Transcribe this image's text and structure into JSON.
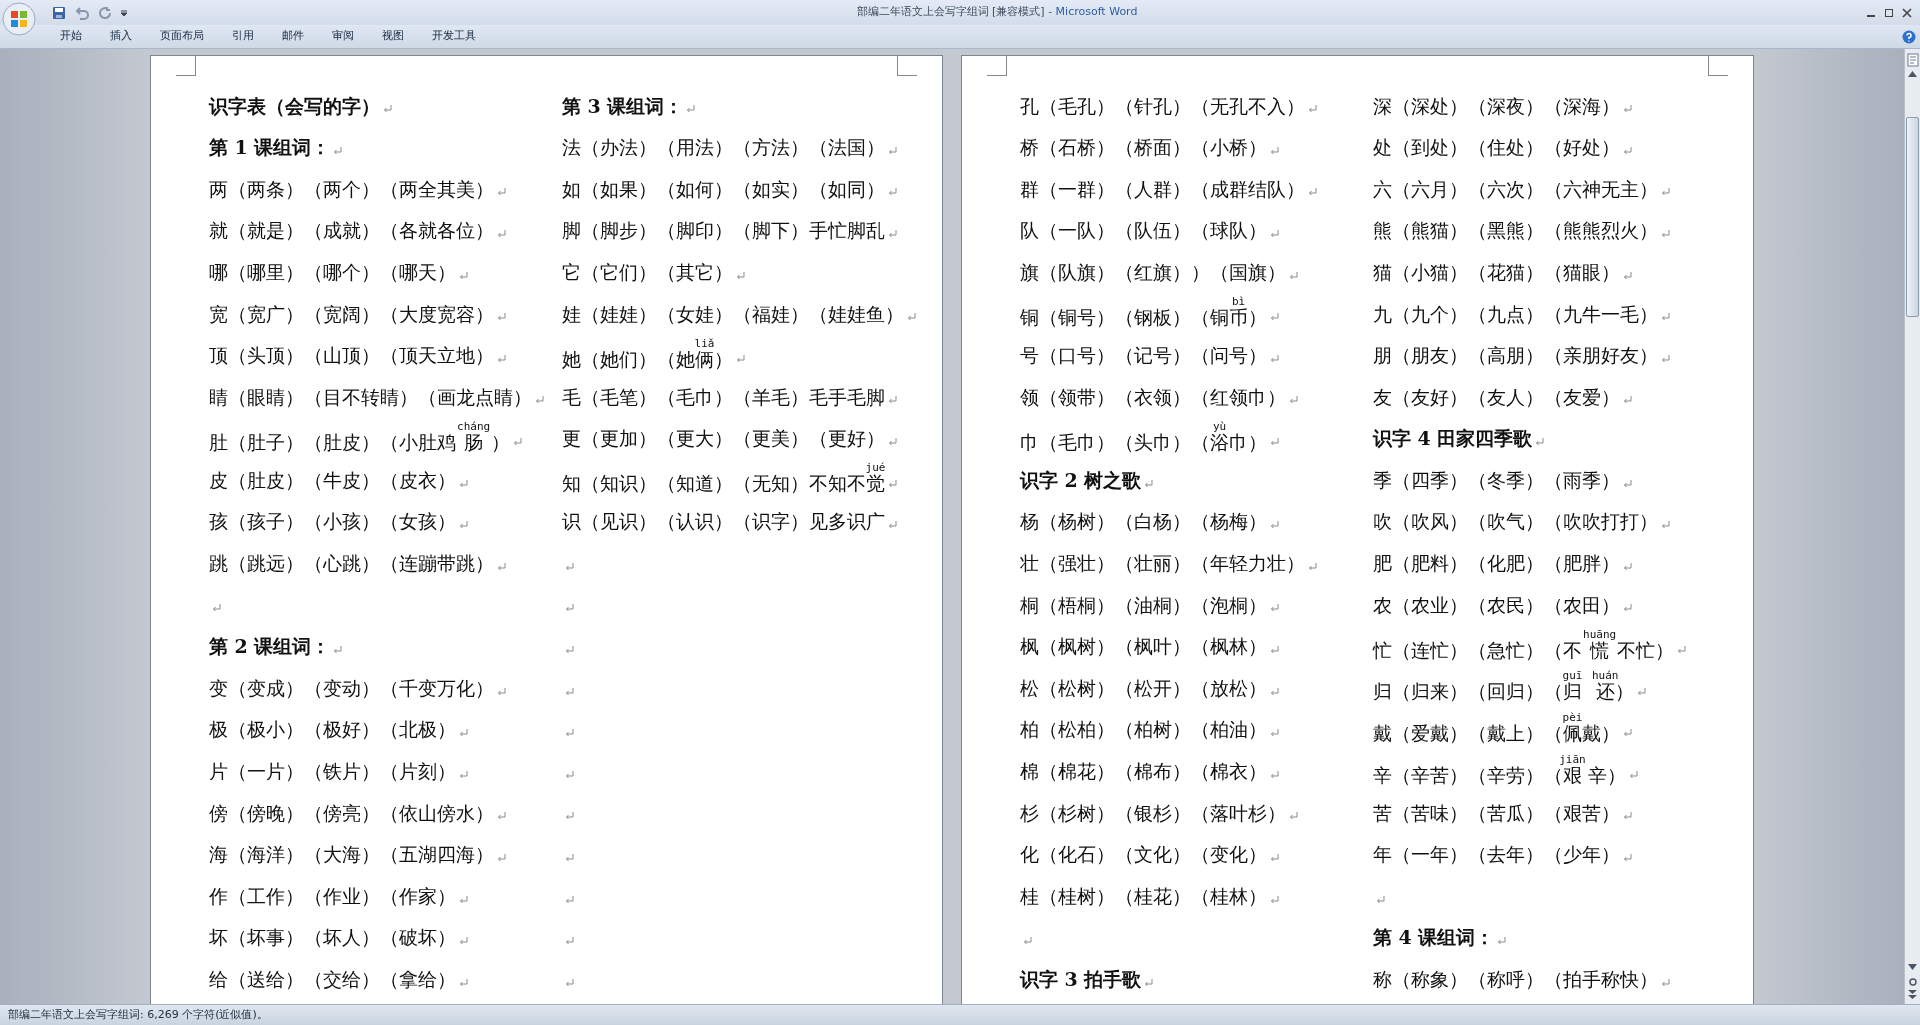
{
  "window": {
    "document": "部编二年语文上会写字组词 [兼容模式]",
    "app": "- Microsoft Word"
  },
  "ribbon_tabs": [
    {
      "label": "开始",
      "selected": false
    },
    {
      "label": "插入",
      "selected": false
    },
    {
      "label": "页面布局",
      "selected": false
    },
    {
      "label": "引用",
      "selected": false
    },
    {
      "label": "邮件",
      "selected": false
    },
    {
      "label": "审阅",
      "selected": false
    },
    {
      "label": "视图",
      "selected": false
    },
    {
      "label": "开发工具",
      "selected": false
    }
  ],
  "pages": [
    {
      "columns": [
        [
          {
            "kind": "heading",
            "text": "识字表（会写的字）"
          },
          {
            "kind": "heading",
            "text": "第 1 课组词："
          },
          {
            "kind": "entry",
            "text": "两（两条）（两个）（两全其美）"
          },
          {
            "kind": "entry",
            "text": "就（就是）（成就）（各就各位）"
          },
          {
            "kind": "entry",
            "text": "哪（哪里）（哪个）（哪天）"
          },
          {
            "kind": "entry",
            "text": "宽（宽广）（宽阔）（大度宽容）"
          },
          {
            "kind": "entry",
            "text": "顶（头顶）（山顶）（顶天立地）"
          },
          {
            "kind": "entry",
            "text": "睛（眼睛）（目不转睛）（画龙点睛）"
          },
          {
            "kind": "entry",
            "parts": [
              {
                "text": "肚（肚子）（肚皮）（小肚鸡 "
              },
              {
                "base": "肠",
                "pinyin": "cháng"
              },
              {
                "text": " ）"
              }
            ]
          },
          {
            "kind": "entry",
            "text": "皮（肚皮）（牛皮）（皮衣）"
          },
          {
            "kind": "entry",
            "text": "孩（孩子）（小孩）（女孩）"
          },
          {
            "kind": "entry",
            "text": "跳（跳远）（心跳）（连蹦带跳）"
          },
          {
            "kind": "empty"
          },
          {
            "kind": "heading",
            "text": "第 2 课组词："
          },
          {
            "kind": "entry",
            "text": "变（变成）（变动）（千变万化）"
          },
          {
            "kind": "entry",
            "text": "极（极小）（极好）（北极）"
          },
          {
            "kind": "entry",
            "text": "片（一片）（铁片）（片刻）"
          },
          {
            "kind": "entry",
            "text": "傍（傍晚）（傍亮）（依山傍水）"
          },
          {
            "kind": "entry",
            "text": "海（海洋）（大海）（五湖四海）"
          },
          {
            "kind": "entry",
            "text": "作（工作）（作业）（作家）"
          },
          {
            "kind": "entry",
            "text": "坏（坏事）（坏人）（破坏）"
          },
          {
            "kind": "entry",
            "text": "给（送给）（交给）（拿给）"
          }
        ],
        [
          {
            "kind": "heading",
            "text": "第 3 课组词："
          },
          {
            "kind": "entry",
            "text": "法（办法）（用法）（方法）（法国）"
          },
          {
            "kind": "entry",
            "text": "如（如果）（如何）（如实）（如同）"
          },
          {
            "kind": "entry",
            "text": "脚（脚步）（脚印）（脚下）手忙脚乱"
          },
          {
            "kind": "entry",
            "text": "它（它们）（其它）"
          },
          {
            "kind": "entry",
            "text": "娃（娃娃）（女娃）（福娃）（娃娃鱼）"
          },
          {
            "kind": "entry",
            "parts": [
              {
                "text": "她（她们）（她"
              },
              {
                "base": "俩",
                "pinyin": "liǎ"
              },
              {
                "text": "）"
              }
            ]
          },
          {
            "kind": "entry",
            "text": "毛（毛笔）（毛巾）（羊毛）毛手毛脚"
          },
          {
            "kind": "entry",
            "text": "更（更加）（更大）（更美）（更好）"
          },
          {
            "kind": "entry",
            "parts": [
              {
                "text": "知（知识）（知道）（无知）不知不"
              },
              {
                "base": "觉",
                "pinyin": "jué"
              }
            ]
          },
          {
            "kind": "entry",
            "text": "识（见识）（认识）（识字）见多识广"
          },
          {
            "kind": "empty"
          },
          {
            "kind": "empty"
          },
          {
            "kind": "empty"
          },
          {
            "kind": "empty"
          },
          {
            "kind": "empty"
          },
          {
            "kind": "empty"
          },
          {
            "kind": "empty"
          },
          {
            "kind": "empty"
          },
          {
            "kind": "empty"
          },
          {
            "kind": "empty"
          },
          {
            "kind": "empty"
          }
        ]
      ]
    },
    {
      "columns": [
        [
          {
            "kind": "entry",
            "text": "孔（毛孔）（针孔）（无孔不入）"
          },
          {
            "kind": "entry",
            "text": "桥（石桥）（桥面）（小桥）"
          },
          {
            "kind": "entry",
            "text": "群（一群）（人群）（成群结队）"
          },
          {
            "kind": "entry",
            "text": "队（一队）（队伍）（球队）"
          },
          {
            "kind": "entry",
            "text": "旗（队旗）（红旗））（国旗）"
          },
          {
            "kind": "entry",
            "parts": [
              {
                "text": "铜（铜号）（钢板）（铜"
              },
              {
                "base": "币",
                "pinyin": "bì"
              },
              {
                "text": "）"
              }
            ]
          },
          {
            "kind": "entry",
            "text": "号（口号）（记号）（问号）"
          },
          {
            "kind": "entry",
            "text": "领（领带）（衣领）（红领巾）"
          },
          {
            "kind": "entry",
            "parts": [
              {
                "text": "巾（毛巾）（头巾）（"
              },
              {
                "base": "浴",
                "pinyin": "yù"
              },
              {
                "text": "巾）"
              }
            ]
          },
          {
            "kind": "heading",
            "text": "识字 2 树之歌"
          },
          {
            "kind": "entry",
            "text": "杨（杨树）（白杨）（杨梅）"
          },
          {
            "kind": "entry",
            "text": "壮（强壮）（壮丽）（年轻力壮）"
          },
          {
            "kind": "entry",
            "text": "桐（梧桐）（油桐）（泡桐）"
          },
          {
            "kind": "entry",
            "text": "枫（枫树）（枫叶）（枫林）"
          },
          {
            "kind": "entry",
            "text": "松（松树）（松开）（放松）"
          },
          {
            "kind": "entry",
            "text": "柏（松柏）（柏树）（柏油）"
          },
          {
            "kind": "entry",
            "text": "棉（棉花）（棉布）（棉衣）"
          },
          {
            "kind": "entry",
            "text": "杉（杉树）（银杉）（落叶杉）"
          },
          {
            "kind": "entry",
            "text": "化（化石）（文化）（变化）"
          },
          {
            "kind": "entry",
            "text": "桂（桂树）（桂花）（桂林）"
          },
          {
            "kind": "empty"
          },
          {
            "kind": "heading",
            "text": "识字 3 拍手歌"
          }
        ],
        [
          {
            "kind": "entry",
            "text": "深（深处）（深夜）（深海）"
          },
          {
            "kind": "entry",
            "text": "处（到处）（住处）（好处）"
          },
          {
            "kind": "entry",
            "text": "六（六月）（六次）（六神无主）"
          },
          {
            "kind": "entry",
            "text": "熊（熊猫）（黑熊）（熊熊烈火）"
          },
          {
            "kind": "entry",
            "text": "猫（小猫）（花猫）（猫眼）"
          },
          {
            "kind": "entry",
            "text": "九（九个）（九点）（九牛一毛）"
          },
          {
            "kind": "entry",
            "text": "朋（朋友）（高朋）（亲朋好友）"
          },
          {
            "kind": "entry",
            "text": "友（友好）（友人）（友爱）"
          },
          {
            "kind": "heading",
            "text": "识字 4 田家四季歌"
          },
          {
            "kind": "entry",
            "text": "季（四季）（冬季）（雨季）"
          },
          {
            "kind": "entry",
            "text": "吹（吹风）（吹气）（吹吹打打）"
          },
          {
            "kind": "entry",
            "text": "肥（肥料）（化肥）（肥胖）"
          },
          {
            "kind": "entry",
            "text": "农（农业）（农民）（农田）"
          },
          {
            "kind": "entry",
            "parts": [
              {
                "text": "忙（连忙）（急忙）（不 "
              },
              {
                "base": "慌",
                "pinyin": "huāng"
              },
              {
                "text": " 不忙）"
              }
            ]
          },
          {
            "kind": "entry",
            "parts": [
              {
                "text": "归（归来）（回归）（"
              },
              {
                "base": "归",
                "pinyin": "guī"
              },
              {
                "base": "还",
                "pinyin": "huán"
              },
              {
                "text": "）"
              }
            ]
          },
          {
            "kind": "entry",
            "parts": [
              {
                "text": "戴（爱戴）（戴上）（"
              },
              {
                "base": "佩",
                "pinyin": "pèi"
              },
              {
                "text": "戴）"
              }
            ]
          },
          {
            "kind": "entry",
            "parts": [
              {
                "text": "辛（辛苦）（辛劳）（"
              },
              {
                "base": "艰",
                "pinyin": "jiān"
              },
              {
                "text": " 辛）"
              }
            ]
          },
          {
            "kind": "entry",
            "text": "苦（苦味）（苦瓜）（艰苦）"
          },
          {
            "kind": "entry",
            "text": "年（一年）（去年）（少年）"
          },
          {
            "kind": "empty"
          },
          {
            "kind": "heading",
            "text": "第 4 课组词："
          },
          {
            "kind": "entry",
            "text": "称（称象）（称呼）（拍手称快）"
          }
        ]
      ]
    }
  ],
  "status_bar": "部编二年语文上会写字组词: 6,269 个字符(近似值)。"
}
